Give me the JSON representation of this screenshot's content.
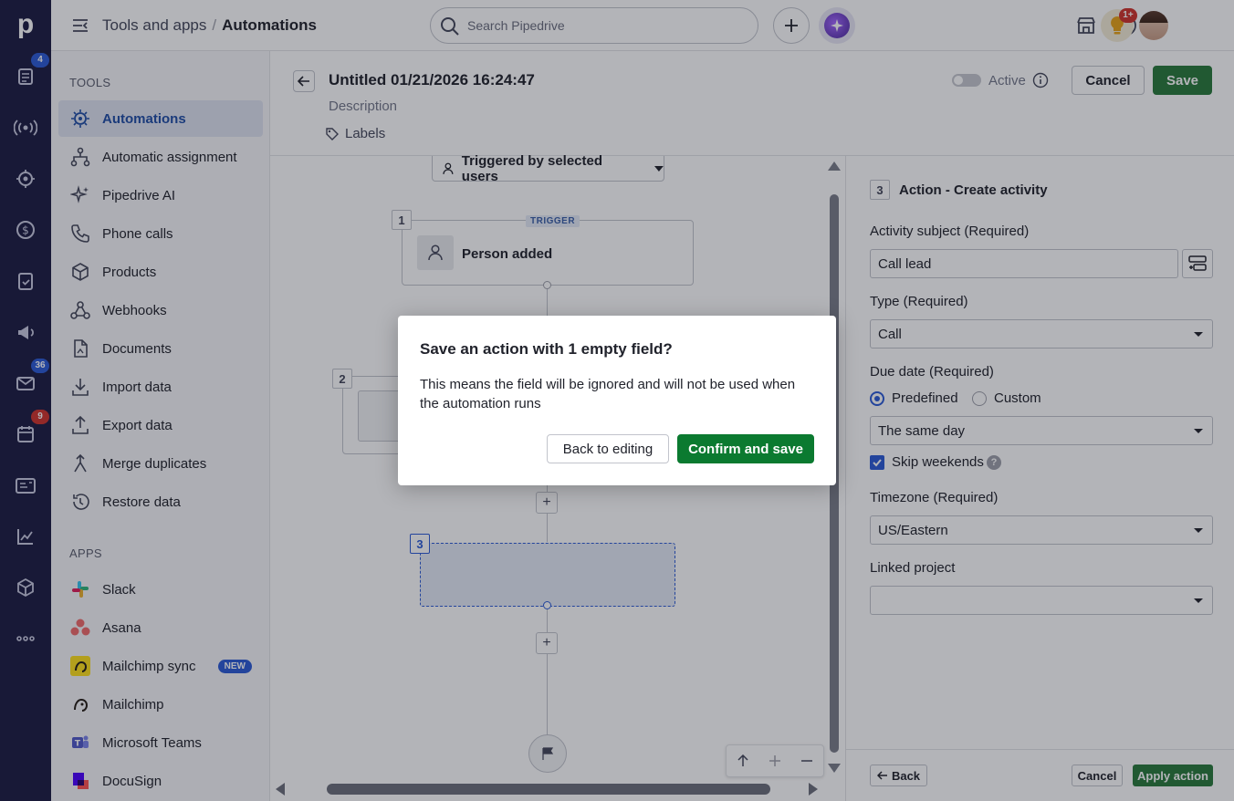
{
  "rail": {
    "logo": "p",
    "badges": {
      "leads": "4",
      "mail": "36",
      "activities": "9"
    }
  },
  "topbar": {
    "breadcrumb_parent": "Tools and apps",
    "breadcrumb_sep": "/",
    "breadcrumb_current": "Automations",
    "search_placeholder": "Search Pipedrive",
    "notifications_badge": "1+"
  },
  "sidebar": {
    "tools_title": "TOOLS",
    "tools": [
      {
        "label": "Automations",
        "icon": "automations-icon"
      },
      {
        "label": "Automatic assignment",
        "icon": "assignment-icon"
      },
      {
        "label": "Pipedrive AI",
        "icon": "sparkle-icon"
      },
      {
        "label": "Phone calls",
        "icon": "phone-icon"
      },
      {
        "label": "Products",
        "icon": "box-icon"
      },
      {
        "label": "Webhooks",
        "icon": "webhook-icon"
      },
      {
        "label": "Documents",
        "icon": "document-icon"
      },
      {
        "label": "Import data",
        "icon": "import-icon"
      },
      {
        "label": "Export data",
        "icon": "export-icon"
      },
      {
        "label": "Merge duplicates",
        "icon": "merge-icon"
      },
      {
        "label": "Restore data",
        "icon": "restore-icon"
      }
    ],
    "apps_title": "APPS",
    "apps": [
      {
        "label": "Slack",
        "icon": "slack-icon"
      },
      {
        "label": "Asana",
        "icon": "asana-icon"
      },
      {
        "label": "Mailchimp sync",
        "icon": "mailchimp-icon",
        "badge": "NEW"
      },
      {
        "label": "Mailchimp",
        "icon": "mailchimp-icon"
      },
      {
        "label": "Microsoft Teams",
        "icon": "teams-icon"
      },
      {
        "label": "DocuSign",
        "icon": "docusign-icon"
      }
    ]
  },
  "editor": {
    "title": "Untitled 01/21/2026 16:24:47",
    "description_placeholder": "Description",
    "labels": "Labels",
    "active_label": "Active",
    "cancel": "Cancel",
    "save": "Save"
  },
  "canvas": {
    "trigger_dropdown": "Triggered by selected users",
    "step1_num": "1",
    "trigger_tag": "TRIGGER",
    "step1_label": "Person added",
    "step2_num": "2",
    "step3_num": "3"
  },
  "panel": {
    "step_num": "3",
    "title": "Action - Create activity",
    "subject_label": "Activity subject (Required)",
    "subject_value": "Call lead",
    "type_label": "Type (Required)",
    "type_value": "Call",
    "due_label": "Due date (Required)",
    "due_predefined": "Predefined",
    "due_custom": "Custom",
    "due_value": "The same day",
    "skip_weekends": "Skip weekends",
    "timezone_label": "Timezone (Required)",
    "timezone_value": "US/Eastern",
    "project_label": "Linked project",
    "project_value": "",
    "back": "Back",
    "cancel": "Cancel",
    "apply": "Apply action"
  },
  "modal": {
    "title": "Save an action with 1 empty field?",
    "body": "This means the field will be ignored and will not be used when the automation runs",
    "back_button": "Back to editing",
    "confirm_button": "Confirm and save"
  },
  "colors": {
    "rail": "#1b1b42",
    "primary_green": "#297a3a",
    "confirm_green": "#0b7a30",
    "accent_blue": "#2b5bd6",
    "badge_red": "#d0332c"
  }
}
